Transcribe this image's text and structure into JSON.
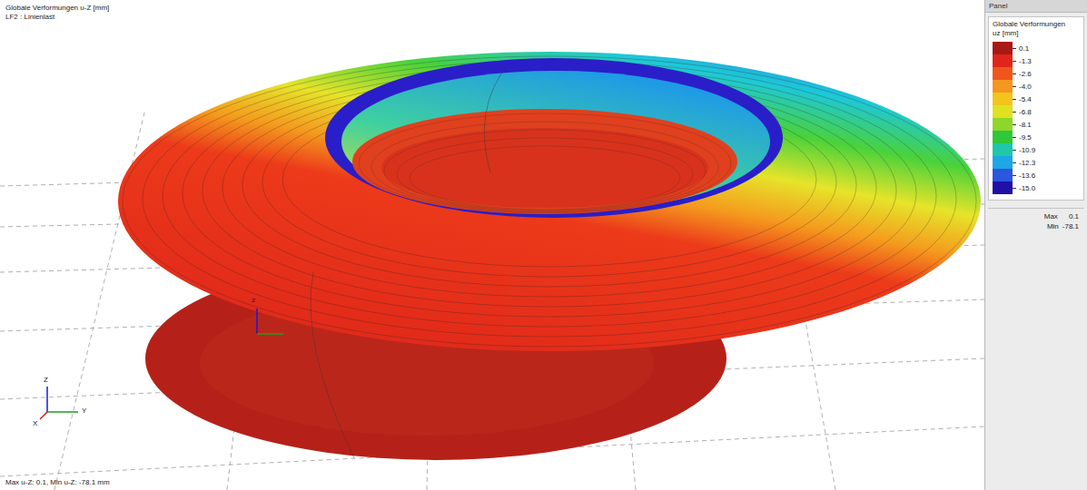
{
  "viewport": {
    "title": "Globale Verformungen u-Z [mm]",
    "load_case": "LF2 : Linienlast",
    "summary": "Max u-Z: 0.1, Min u-Z: -78.1 mm",
    "axes": [
      "Z",
      "Y",
      "X"
    ],
    "model_axis_label": "z"
  },
  "panel": {
    "title": "Panel",
    "legend_title": "Globale Verformungen",
    "legend_unit": "uz [mm]",
    "scale": [
      {
        "value": "0.1",
        "color": "#a81a16"
      },
      {
        "value": "-1.3",
        "color": "#e0261a"
      },
      {
        "value": "-2.6",
        "color": "#f0561c"
      },
      {
        "value": "-4.0",
        "color": "#f5961e"
      },
      {
        "value": "-5.4",
        "color": "#f2c41c"
      },
      {
        "value": "-6.8",
        "color": "#dfe21e"
      },
      {
        "value": "-8.1",
        "color": "#8fd62a"
      },
      {
        "value": "-9.5",
        "color": "#2ec83a"
      },
      {
        "value": "-10.9",
        "color": "#1ec8a8"
      },
      {
        "value": "-12.3",
        "color": "#1ea6e6"
      },
      {
        "value": "-13.6",
        "color": "#2a56e0"
      },
      {
        "value": "-15.0",
        "color": "#2010a8"
      }
    ],
    "max_label": "Max",
    "max_value": "0.1",
    "min_label": "Min",
    "min_value": "-78.1"
  }
}
